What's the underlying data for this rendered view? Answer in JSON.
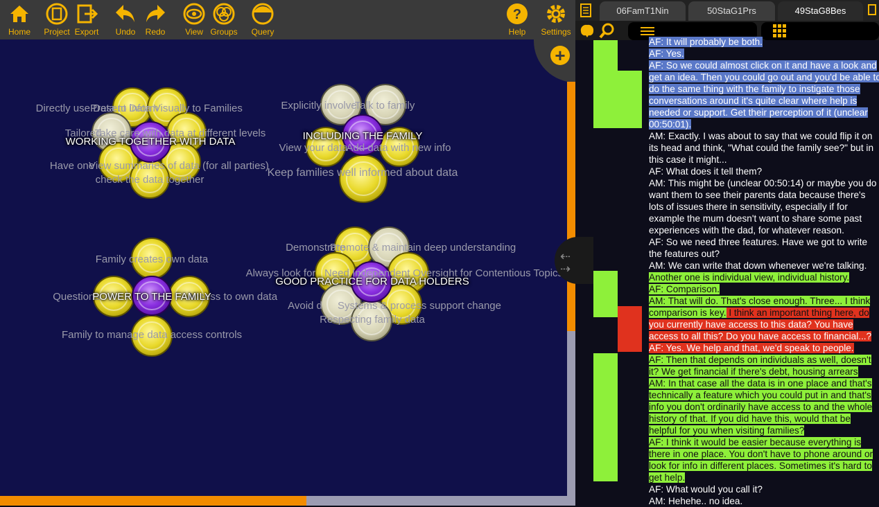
{
  "toolbar": {
    "buttons": [
      {
        "label": "Home",
        "icon": "home-icon"
      },
      {
        "label": "Project",
        "icon": "project-icon"
      },
      {
        "label": "Export",
        "icon": "export-icon"
      },
      {
        "label": "Undo",
        "icon": "undo-icon"
      },
      {
        "label": "Redo",
        "icon": "redo-icon"
      },
      {
        "label": "View",
        "icon": "eye-icon"
      },
      {
        "label": "Groups",
        "icon": "groups-icon"
      },
      {
        "label": "Query",
        "icon": "query-icon"
      },
      {
        "label": "Help",
        "icon": "help-icon"
      },
      {
        "label": "Settings",
        "icon": "gear-icon"
      }
    ],
    "accent": "#f5b400"
  },
  "tabs": [
    {
      "label": "06FamT1Nin",
      "active": false
    },
    {
      "label": "50StaG1Prs",
      "active": false
    },
    {
      "label": "49StaG8Bes",
      "active": true
    }
  ],
  "clusters": {
    "working": {
      "title": "WORKING TOGETHER WITH DATA",
      "labels": [
        "Directly use Data to inform",
        "Present Data Visually to Families",
        "Take care with data at different levels",
        "Tailored",
        "View summaries of data (for all parties)",
        "Have one",
        "check the data together"
      ]
    },
    "including": {
      "title": "INCLUDING THE FAMILY",
      "labels": [
        "Explicitly involve",
        "Talk to family",
        "View your data",
        "Add data with new info",
        "Keep families well informed about data"
      ]
    },
    "power": {
      "title": "POWER TO THE FAMILY",
      "labels": [
        "Family creates own data",
        "Questions",
        "Access to own data",
        "Family to manage data access controls"
      ]
    },
    "good": {
      "title": "GOOD PRACTICE FOR DATA HOLDERS",
      "labels": [
        "Demonstrate",
        "Promote & maintain deep understanding",
        "Always look for",
        "Need Independent Oversight for Contentious Topics",
        "Avoid d",
        "Systems & process support change",
        "Respecting family data"
      ]
    }
  },
  "transcript": [
    {
      "text": "AF: It will probably be both.",
      "hl": "b"
    },
    {
      "text": "AF: Yes.",
      "hl": "b"
    },
    {
      "text": "AF: So we could almost click on it and have a look and",
      "hl": "b"
    },
    {
      "text": "get an idea. Then you could go out and you'd be able to",
      "hl": "b"
    },
    {
      "text": "do the same thing with the family to instigate those",
      "hl": "b"
    },
    {
      "text": "conversations around it's quite clear where help is",
      "hl": "b"
    },
    {
      "text": "needed or support. Get their perception of it (unclear",
      "hl": "b"
    },
    {
      "text": "00:50:01).",
      "hl": "b"
    },
    {
      "text": "AM: Exactly. I was about to say that we could flip it on",
      "hl": ""
    },
    {
      "text": "its head and think, \"What could the family see?\" but in",
      "hl": ""
    },
    {
      "text": "this case it might...",
      "hl": ""
    },
    {
      "text": "AF: What does it tell them?",
      "hl": ""
    },
    {
      "text": "AM: This might be (unclear 00:50:14) or maybe you do",
      "hl": ""
    },
    {
      "text": "want them to see their parents data because there's",
      "hl": ""
    },
    {
      "text": "lots of issues there in sensitivity, especially if for",
      "hl": ""
    },
    {
      "text": "example the mum doesn't want to share some past",
      "hl": ""
    },
    {
      "text": "experiences with the dad, for whatever reason.",
      "hl": ""
    },
    {
      "text": "AF: So we need three features. Have we got to write",
      "hl": ""
    },
    {
      "text": "the features out?",
      "hl": ""
    },
    {
      "text": "AM: We can write that down whenever we're talking.",
      "hl": ""
    },
    {
      "text": "Another one is individual view, individual history.",
      "hl": "g"
    },
    {
      "text": "AF: Comparison.",
      "hl": "g"
    },
    {
      "text": "AM: That will do. That's close enough. Three... I think",
      "hl": "g"
    },
    {
      "text": "comparison is key. I think an important thing here, do",
      "hl": "gr"
    },
    {
      "text": "you currently have access to this data? You have",
      "hl": "r"
    },
    {
      "text": "access to all this? Do you have access to financial...?",
      "hl": "r"
    },
    {
      "text": "AF: Yes. We help and that, we'd speak to people.",
      "hl": "r"
    },
    {
      "text": "AF: Then that depends on individuals as well, doesn't",
      "hl": "g"
    },
    {
      "text": "it? We get financial if there's debt, housing arrears",
      "hl": "g"
    },
    {
      "text": "AM: In that case all the data is in one place and that's",
      "hl": "g"
    },
    {
      "text": "technically a feature which you could put in and that's",
      "hl": "g"
    },
    {
      "text": "info you don't ordinarily have access to and the whole",
      "hl": "g"
    },
    {
      "text": "history of that. If you did have this, would that be",
      "hl": "g"
    },
    {
      "text": "helpful for you when visiting families?",
      "hl": "g"
    },
    {
      "text": "AF: I think it would be easier because everything is",
      "hl": "g"
    },
    {
      "text": "there in one place. You don't have to phone around or",
      "hl": "g"
    },
    {
      "text": "look for info in different places. Sometimes it's hard to",
      "hl": "g"
    },
    {
      "text": "get help.",
      "hl": "g"
    },
    {
      "text": "AF: What would you call it?",
      "hl": ""
    },
    {
      "text": "AM: Hehehe.. no idea.",
      "hl": ""
    }
  ],
  "colors": {
    "canvas": "#10104a",
    "highlight_green": "#8ef03a",
    "highlight_red": "#e0321e",
    "highlight_blue": "#5a78c8",
    "scroll": "#f28c00"
  }
}
